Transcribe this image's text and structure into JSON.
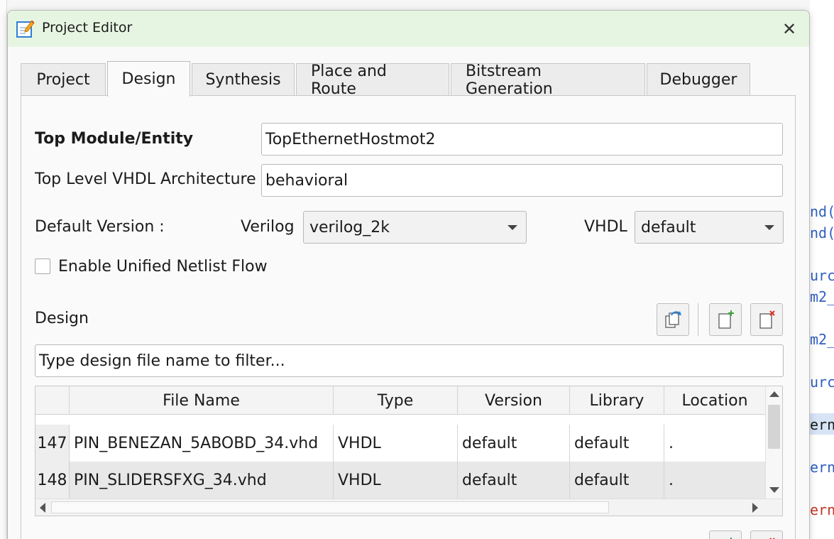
{
  "dialog": {
    "title": "Project Editor",
    "close_glyph": "✕"
  },
  "tabs": [
    {
      "label": "Project"
    },
    {
      "label": "Design"
    },
    {
      "label": "Synthesis"
    },
    {
      "label": "Place and Route"
    },
    {
      "label": "Bitstream Generation"
    },
    {
      "label": "Debugger"
    }
  ],
  "active_tab": "Design",
  "form": {
    "top_module_label": "Top Module/Entity",
    "top_module_value": "TopEthernetHostmot2",
    "architecture_label": "Top Level VHDL Architecture",
    "architecture_value": "behavioral",
    "default_version_label": "Default Version :",
    "verilog_label": "Verilog",
    "verilog_value": "verilog_2k",
    "vhdl_label": "VHDL",
    "vhdl_value": "default",
    "unified_netlist_label": "Enable Unified Netlist Flow",
    "unified_netlist_checked": false
  },
  "design_section": {
    "label": "Design",
    "filter_placeholder": "Type design file name to filter..."
  },
  "table": {
    "columns": [
      "File Name",
      "Type",
      "Version",
      "Library",
      "Location"
    ],
    "rows": [
      {
        "num": "147",
        "file": "PIN_BENEZAN_5ABOBD_34.vhd",
        "type": "VHDL",
        "version": "default",
        "library": "default",
        "location": "."
      },
      {
        "num": "148",
        "file": "PIN_SLIDERSFXG_34.vhd",
        "type": "VHDL",
        "version": "default",
        "library": "default",
        "location": "."
      }
    ]
  },
  "background_code_fragments": [
    {
      "text": "nd(",
      "color": "#2f5fbf"
    },
    {
      "text": "nd(",
      "color": "#2f5fbf"
    },
    {
      "text": "urc",
      "color": "#2f5fbf"
    },
    {
      "text": "m2_",
      "color": "#2f5fbf"
    },
    {
      "text": "m2_",
      "color": "#2f5fbf"
    },
    {
      "text": "urc",
      "color": "#2f5fbf"
    },
    {
      "text": "ern",
      "color": "#1b1b1b"
    },
    {
      "text": "ern",
      "color": "#2f5fbf"
    },
    {
      "text": "ern",
      "color": "#c0392b"
    }
  ],
  "colors": {
    "titlebar_bg": "#e6f5e1",
    "accent_green": "#3aa53a",
    "accent_red": "#d93025",
    "accent_blue": "#2f7fd1"
  }
}
